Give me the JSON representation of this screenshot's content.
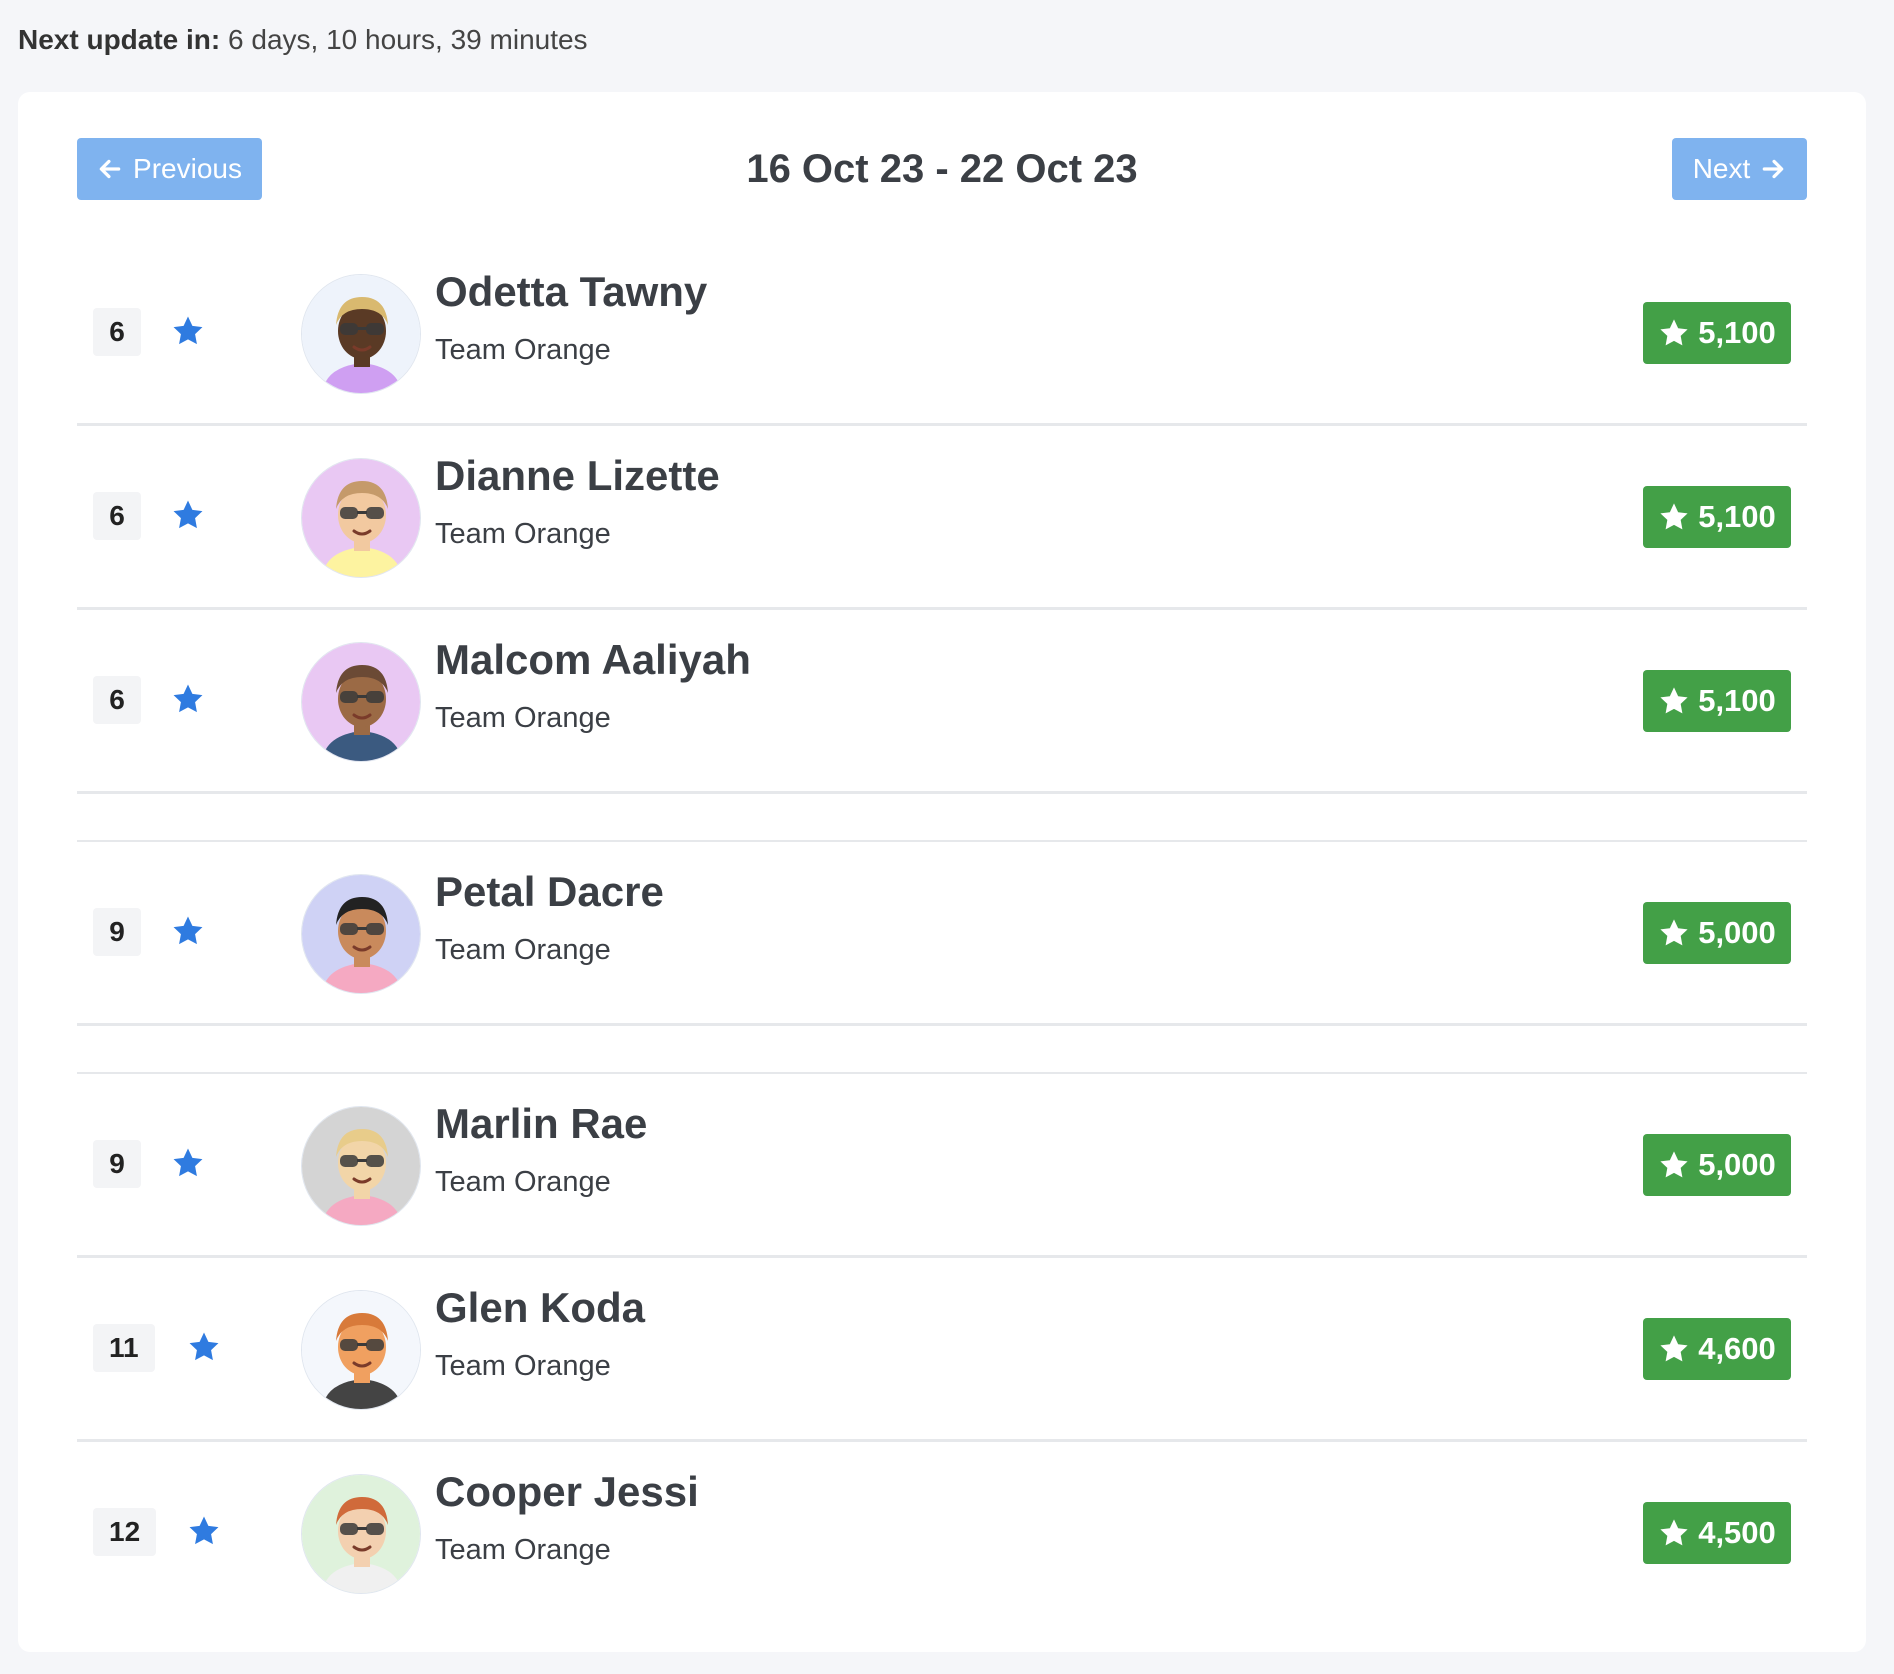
{
  "header": {
    "label": "Next update in:",
    "value": "6 days, 10 hours, 39 minutes"
  },
  "nav": {
    "previous_label": "Previous",
    "next_label": "Next",
    "date_range": "16 Oct 23 - 22 Oct 23"
  },
  "colors": {
    "accent": "#7fb3ef",
    "score_bg": "#43a047",
    "star": "#2f7be0"
  },
  "leaderboard": [
    {
      "rank": "6",
      "name": "Odetta Tawny",
      "team": "Team Orange",
      "score": "5,100",
      "avatar_bg": "#eef3fb",
      "skin": "#5a3a25",
      "hair": "#d9b96f",
      "shirt": "#cf9ff2"
    },
    {
      "rank": "6",
      "name": "Dianne Lizette",
      "team": "Team Orange",
      "score": "5,100",
      "avatar_bg": "#e9c8f3",
      "skin": "#f2c9a0",
      "hair": "#c59a6a",
      "shirt": "#fdf3a0"
    },
    {
      "rank": "6",
      "name": "Malcom Aaliyah",
      "team": "Team Orange",
      "score": "5,100",
      "avatar_bg": "#e9c8f3",
      "skin": "#9b6a45",
      "hair": "#6b4a35",
      "shirt": "#3b5a80"
    },
    {
      "rank": "9",
      "name": "Petal Dacre",
      "team": "Team Orange",
      "score": "5,000",
      "avatar_bg": "#cfd2f5",
      "skin": "#c98a5c",
      "hair": "#222222",
      "shirt": "#f5a9c2"
    },
    {
      "rank": "9",
      "name": "Marlin Rae",
      "team": "Team Orange",
      "score": "5,000",
      "avatar_bg": "#d4d4d4",
      "skin": "#f2d5a8",
      "hair": "#e8cc8a",
      "shirt": "#f5a9c2"
    },
    {
      "rank": "11",
      "name": "Glen Koda",
      "team": "Team Orange",
      "score": "4,600",
      "avatar_bg": "#f4f7fc",
      "skin": "#f0a060",
      "hair": "#d87a3a",
      "shirt": "#444444"
    },
    {
      "rank": "12",
      "name": "Cooper Jessi",
      "team": "Team Orange",
      "score": "4,500",
      "avatar_bg": "#dff2dc",
      "skin": "#f3d0b0",
      "hair": "#d06a3a",
      "shirt": "#f0f0f0"
    }
  ]
}
